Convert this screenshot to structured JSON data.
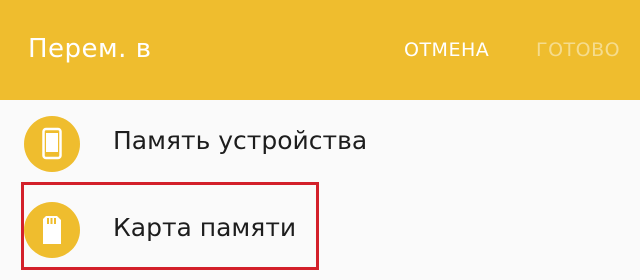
{
  "header": {
    "title": "Перем. в",
    "cancel_label": "ОТМЕНА",
    "done_label": "ГОТОВО"
  },
  "locations": [
    {
      "label": "Память устройства",
      "icon": "phone-icon"
    },
    {
      "label": "Карта памяти",
      "icon": "sd-card-icon"
    }
  ],
  "colors": {
    "header": "#efbd2e",
    "done_disabled": "#f5dc8e",
    "highlight": "#d3202a"
  }
}
